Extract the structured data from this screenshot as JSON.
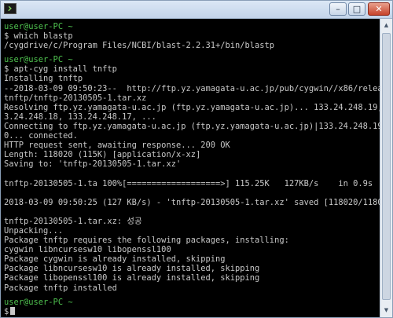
{
  "window": {
    "controls": {
      "minimize": "–",
      "maximize": "□",
      "close": "✕"
    }
  },
  "terminal": {
    "lines": [
      "user@user-PC ~",
      "$ which blastp",
      "/cygdrive/c/Program Files/NCBI/blast-2.2.31+/bin/blastp",
      "user@user-PC ~",
      "$ apt-cyg install tnftp",
      "Installing tnftp",
      "--2018-03-09 09:50:23--  http://ftp.yz.yamagata-u.ac.jp/pub/cygwin//x86/release/",
      "tnftp/tnftp-20130505-1.tar.xz",
      "Resolving ftp.yz.yamagata-u.ac.jp (ftp.yz.yamagata-u.ac.jp)... 133.24.248.19, 13",
      "3.24.248.18, 133.24.248.17, ...",
      "Connecting to ftp.yz.yamagata-u.ac.jp (ftp.yz.yamagata-u.ac.jp)|133.24.248.19|:8",
      "0... connected.",
      "HTTP request sent, awaiting response... 200 OK",
      "Length: 118020 (115K) [application/x-xz]",
      "Saving to: 'tnftp-20130505-1.tar.xz'",
      "",
      "tnftp-20130505-1.ta 100%[===================>] 115.25K   127KB/s    in 0.9s",
      "",
      "2018-03-09 09:50:25 (127 KB/s) - 'tnftp-20130505-1.tar.xz' saved [118020/118020]",
      "",
      "tnftp-20130505-1.tar.xz: 성공",
      "Unpacking...",
      "Package tnftp requires the following packages, installing:",
      "cygwin libncursesw10 libopenssl100",
      "Package cygwin is already installed, skipping",
      "Package libncursesw10 is already installed, skipping",
      "Package libopenssl100 is already installed, skipping",
      "Package tnftp installed",
      "user@user-PC ~",
      "$"
    ]
  }
}
